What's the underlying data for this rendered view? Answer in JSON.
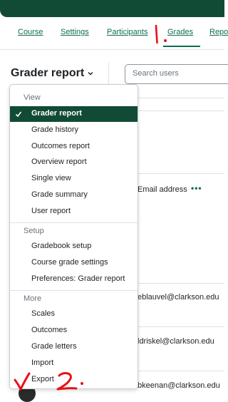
{
  "nav": {
    "tabs": [
      {
        "label": "Course"
      },
      {
        "label": "Settings"
      },
      {
        "label": "Participants"
      },
      {
        "label": "Grades",
        "active": true
      },
      {
        "label": "Repo"
      }
    ]
  },
  "header": {
    "title": "Grader report",
    "chevron_icon": "chevron-down-icon"
  },
  "search": {
    "placeholder": "Search users",
    "value": ""
  },
  "table": {
    "email_header": "Email address",
    "more_icon": "more-dots-icon",
    "emails": [
      "eblauvel@clarkson.edu",
      "ldriskel@clarkson.edu",
      "bkeenan@clarkson.edu"
    ]
  },
  "menu": {
    "sections": [
      {
        "label": "View",
        "items": [
          {
            "label": "Grader report",
            "selected": true
          },
          {
            "label": "Grade history"
          },
          {
            "label": "Outcomes report"
          },
          {
            "label": "Overview report"
          },
          {
            "label": "Single view"
          },
          {
            "label": "Grade summary"
          },
          {
            "label": "User report"
          }
        ]
      },
      {
        "label": "Setup",
        "items": [
          {
            "label": "Gradebook setup"
          },
          {
            "label": "Course grade settings"
          },
          {
            "label": "Preferences: Grader report"
          }
        ]
      },
      {
        "label": "More",
        "items": [
          {
            "label": "Scales"
          },
          {
            "label": "Outcomes"
          },
          {
            "label": "Grade letters"
          },
          {
            "label": "Import"
          },
          {
            "label": "Export"
          }
        ]
      }
    ]
  },
  "annotations": {
    "mark_one": "1.",
    "mark_two": "2.",
    "color": "#e8101a"
  },
  "colors": {
    "brand": "#114b35",
    "link": "#0f6e4f"
  }
}
